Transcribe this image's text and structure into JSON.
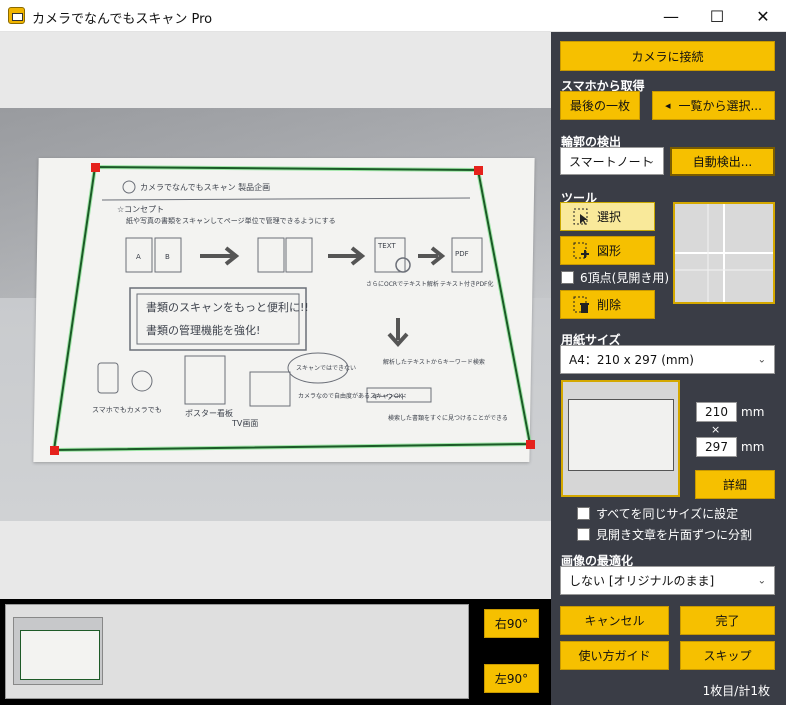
{
  "window": {
    "title": "カメラでなんでもスキャン Pro",
    "minimize_glyph": "—",
    "maximize_glyph": "☐",
    "close_glyph": "✕"
  },
  "viewer": {
    "rotate_right_label": "右90°",
    "rotate_left_label": "左90°"
  },
  "document_text": {
    "header_title": "カメラでなんでもスキャン 製品企画",
    "concept_heading": "☆コンセプト",
    "concept_body": "紙や写真の書類をスキャンしてページ単位で管理できるようにする",
    "flow_a": "A",
    "flow_b": "B",
    "flow_text": "TEXT",
    "flow_pdf": "PDF",
    "ocr_note": "さらにOCRでテキスト解析",
    "pdf_note": "テキスト付きPDF化",
    "highlight_line1": "書類のスキャンをもっと便利に!!",
    "highlight_line2": "書類の管理機能を強化!",
    "phone_label": "スマホでもカメラでも",
    "poster_label": "ポスター看板",
    "tv_label": "TV画面",
    "bubble_text": "スキャンではできない",
    "ok_note": "カメラなので自由度があるスキャンOK",
    "analysis_note": "解析したテキストからキーワード検索",
    "keyword_box": "キーワード",
    "search_note": "検索した書類をすぐに見つけることができる"
  },
  "panel": {
    "connect_camera_label": "カメラに接続",
    "phone_section_label": "スマホから取得",
    "last_one_label": "最後の一枚",
    "select_from_list_label": "一覧から選択...",
    "contour_section_label": "輪郭の検出",
    "contour_mode_value": "スマートノート",
    "auto_detect_label": "自動検出...",
    "tools_section_label": "ツール",
    "select_tool_label": "選択",
    "shape_tool_label": "図形",
    "six_points_label": "6頂点(見開き用)",
    "delete_tool_label": "削除",
    "paper_size_section_label": "用紙サイズ",
    "paper_size_value": "A4：210 x 297 (mm)",
    "width_value": "210",
    "height_value": "297",
    "unit_mm": "mm",
    "times_sign": "×",
    "details_label": "詳細",
    "same_size_label": "すべてを同じサイズに設定",
    "split_spread_label": "見開き文章を片面ずつに分割",
    "optimize_section_label": "画像の最適化",
    "optimize_value": "しない [オリジナルのまま]",
    "cancel_label": "キャンセル",
    "done_label": "完了",
    "guide_label": "使い方ガイド",
    "skip_label": "スキップ",
    "page_counter": "1枚目/計1枚"
  },
  "colors": {
    "accent_yellow": "#f6c000",
    "panel_bg": "#3a3d46",
    "crop_line": "#1b5a27",
    "crop_handle": "#e5221c"
  }
}
